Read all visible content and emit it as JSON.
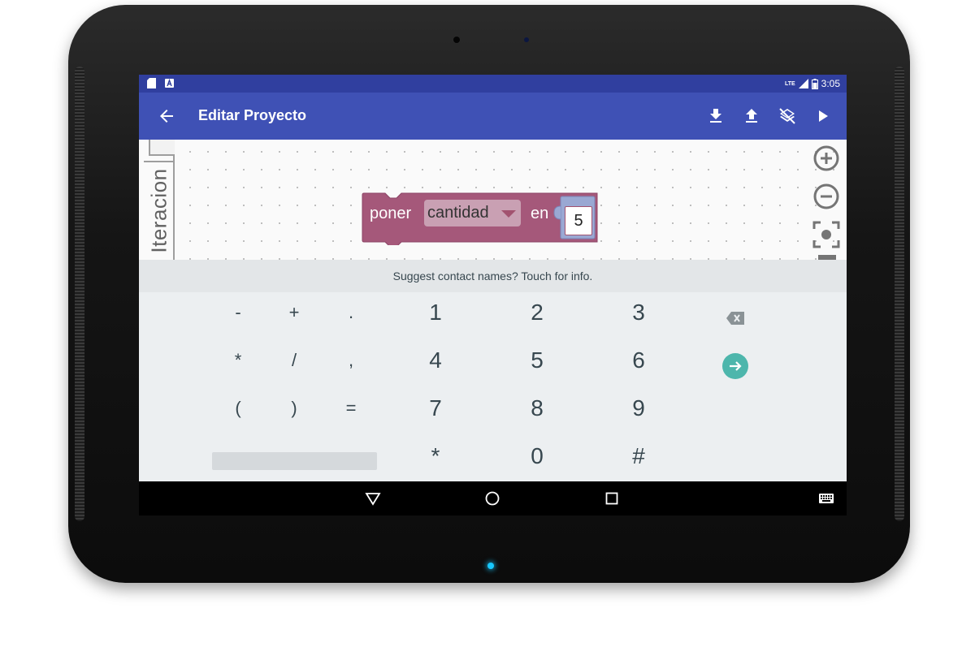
{
  "status_bar": {
    "time": "3:05",
    "network": "LTE",
    "icons": [
      "sd-card-icon",
      "accessibility-a-icon",
      "signal-icon",
      "battery-icon"
    ]
  },
  "app_bar": {
    "title": "Editar Proyecto",
    "actions": [
      "download-icon",
      "upload-icon",
      "layers-clear-icon",
      "play-icon"
    ]
  },
  "flyout": {
    "tab_label": "Iteracion"
  },
  "block": {
    "prefix": "poner",
    "variable": "cantidad",
    "suffix": "en",
    "value": "5",
    "color": "#a5587a"
  },
  "keyboard": {
    "suggestion": "Suggest contact names? Touch for info.",
    "rows": [
      [
        "-",
        "+",
        ".",
        "1",
        "2",
        "3"
      ],
      [
        "*",
        "/",
        ",",
        "4",
        "5",
        "6"
      ],
      [
        "(",
        ")",
        "=",
        "7",
        "8",
        "9"
      ],
      [
        "*",
        "0",
        "#"
      ]
    ],
    "accent": "#4db6ac"
  },
  "colors": {
    "status_bar": "#303f9f",
    "app_bar": "#3f51b5"
  }
}
